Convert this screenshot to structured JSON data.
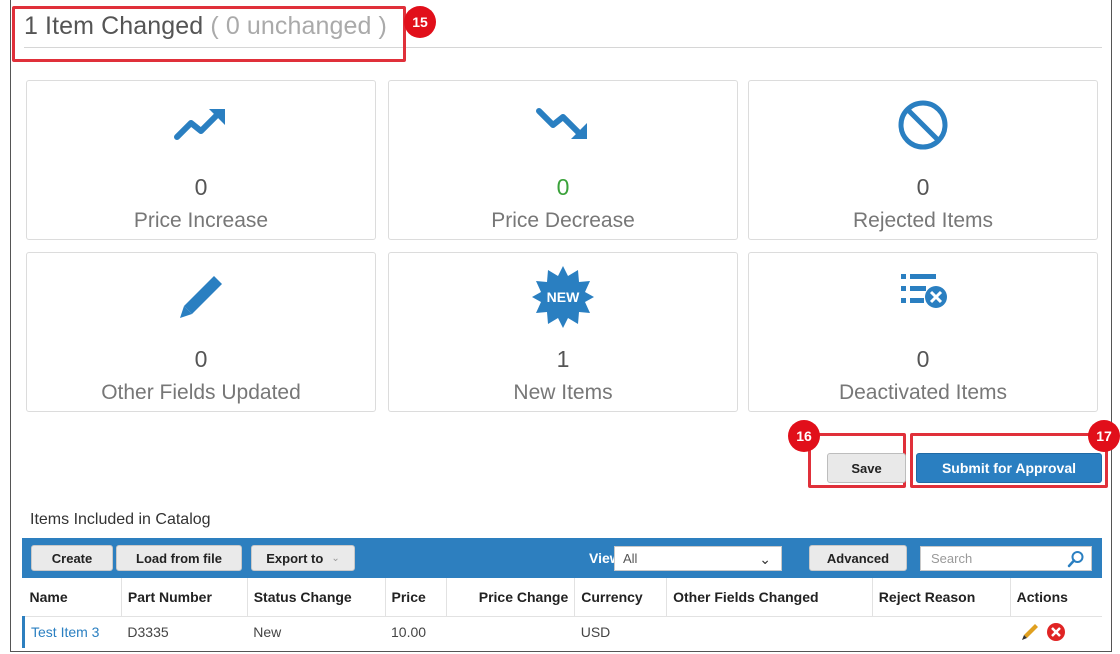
{
  "header": {
    "changed_text": "1 Item Changed",
    "unchanged_text": "( 0 unchanged )"
  },
  "callouts": [
    "15",
    "16",
    "17"
  ],
  "summary_cards": [
    {
      "count": "0",
      "label": "Price Increase",
      "icon": "trending-up-icon"
    },
    {
      "count": "0",
      "label": "Price Decrease",
      "icon": "trending-down-icon"
    },
    {
      "count": "0",
      "label": "Rejected Items",
      "icon": "prohibited-icon"
    },
    {
      "count": "0",
      "label": "Other Fields Updated",
      "icon": "pencil-icon"
    },
    {
      "count": "1",
      "label": "New Items",
      "icon": "new-badge-icon",
      "icon_text": "NEW"
    },
    {
      "count": "0",
      "label": "Deactivated Items",
      "icon": "list-remove-icon"
    }
  ],
  "buttons": {
    "save": "Save",
    "submit": "Submit for Approval"
  },
  "section_title": "Items Included in Catalog",
  "toolbar": {
    "create": "Create",
    "load_from_file": "Load from file",
    "export_to": "Export to",
    "view_label": "View",
    "view_value": "All",
    "advanced": "Advanced",
    "search_placeholder": "Search"
  },
  "table": {
    "columns": [
      "Name",
      "Part Number",
      "Status Change",
      "Price",
      "Price Change",
      "Currency",
      "Other Fields Changed",
      "Reject Reason",
      "Actions"
    ],
    "rows": [
      {
        "name": "Test Item 3",
        "part_number": "D3335",
        "status_change": "New",
        "price": "10.00",
        "price_change": "",
        "currency": "USD",
        "other_fields_changed": "",
        "reject_reason": ""
      }
    ]
  },
  "colors": {
    "accent_blue": "#2a7fc1",
    "toolbar_blue": "#2d7fbf",
    "callout_red": "#e10f1a",
    "green_count": "#3aa23a"
  }
}
